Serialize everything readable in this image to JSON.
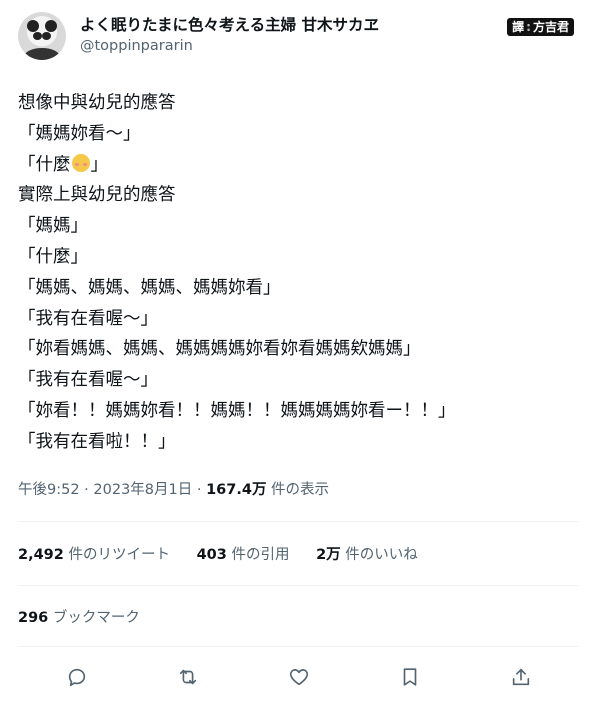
{
  "author": {
    "display_name": "よく眠りたまに色々考える主婦 甘木サカヱ",
    "handle": "@toppinpararin"
  },
  "watermark": {
    "left": "譯",
    "right": "方吉君"
  },
  "tweet": {
    "lines": [
      "想像中與幼兒的應答",
      "「媽媽妳看～」",
      "「什麼",
      "實際上與幼兒的應答",
      "「媽媽」",
      "「什麼」",
      "「媽媽、媽媽、媽媽、媽媽妳看」",
      "「我有在看喔～」",
      "「妳看媽媽、媽媽、媽媽媽媽妳看妳看媽媽欸媽媽」",
      "「我有在看喔～」",
      "「妳看！！媽媽妳看！！媽媽！！媽媽媽媽妳看ー！！」",
      "「我有在看啦！！」"
    ],
    "line3_end": "」",
    "emoji": "smiling-face-with-blush-icon"
  },
  "meta": {
    "time": "午後9:52",
    "sep1": " · ",
    "date": "2023年8月1日",
    "sep2": " · ",
    "views_count": "167.4万",
    "views_label": " 件の表示"
  },
  "stats": {
    "retweets_count": "2,492",
    "retweets_label": " 件のリツイート",
    "quotes_count": "403",
    "quotes_label": " 件の引用",
    "likes_count": "2万",
    "likes_label": " 件のいいね"
  },
  "bookmarks": {
    "count": "296",
    "label": " ブックマーク"
  },
  "actions": [
    "reply-icon",
    "retweet-icon",
    "like-icon",
    "bookmark-icon",
    "share-icon"
  ]
}
